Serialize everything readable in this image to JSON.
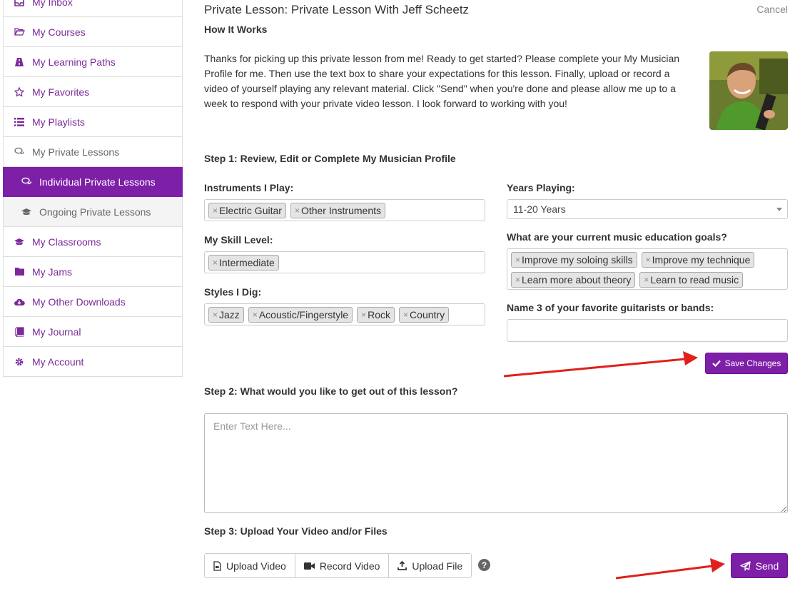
{
  "sidebar": {
    "items": [
      {
        "label": "My Inbox",
        "icon": "inbox-icon"
      },
      {
        "label": "My Courses",
        "icon": "folder-open-icon"
      },
      {
        "label": "My Learning Paths",
        "icon": "road-icon"
      },
      {
        "label": "My Favorites",
        "icon": "star-icon"
      },
      {
        "label": "My Playlists",
        "icon": "list-icon"
      },
      {
        "label": "My Private Lessons",
        "icon": "comments-icon"
      },
      {
        "label": "Individual Private Lessons",
        "icon": "comments-icon"
      },
      {
        "label": "Ongoing Private Lessons",
        "icon": "graduation-cap-icon"
      },
      {
        "label": "My Classrooms",
        "icon": "graduation-cap-icon"
      },
      {
        "label": "My Jams",
        "icon": "folder-music-icon"
      },
      {
        "label": "My Other Downloads",
        "icon": "cloud-download-icon"
      },
      {
        "label": "My Journal",
        "icon": "book-icon"
      },
      {
        "label": "My Account",
        "icon": "gear-icon"
      }
    ]
  },
  "header": {
    "title": "Private Lesson: Private Lesson With Jeff Scheetz",
    "cancel_label": "Cancel"
  },
  "intro": {
    "heading": "How It Works",
    "text": "Thanks for picking up this private lesson from me! Ready to get started? Please complete your My Musician Profile for me. Then use the text box to share your expectations for this lesson. Finally, upload or record a video of yourself playing any relevant material. Click \"Send\" when you're done and please allow me up to a week to respond with your private video lesson. I look forward to working with you!"
  },
  "step1": {
    "heading": "Step 1: Review, Edit or Complete My Musician Profile",
    "instruments": {
      "label": "Instruments I Play:",
      "tags": [
        "Electric Guitar",
        "Other Instruments"
      ]
    },
    "skill": {
      "label": "My Skill Level:",
      "tags": [
        "Intermediate"
      ]
    },
    "styles": {
      "label": "Styles I Dig:",
      "tags": [
        "Jazz",
        "Acoustic/Fingerstyle",
        "Rock",
        "Country"
      ]
    },
    "years": {
      "label": "Years Playing:",
      "value": "11-20 Years"
    },
    "goals": {
      "label": "What are your current music education goals?",
      "tags": [
        "Improve my soloing skills",
        "Improve my technique",
        "Learn more about theory",
        "Learn to read music"
      ]
    },
    "favorites": {
      "label": "Name 3 of your favorite guitarists or bands:",
      "value": ""
    },
    "save_label": "Save Changes",
    "remove_glyph": "×"
  },
  "step2": {
    "heading": "Step 2: What would you like to get out of this lesson?",
    "placeholder": "Enter Text Here..."
  },
  "step3": {
    "heading": "Step 3: Upload Your Video and/or Files",
    "upload_video": "Upload Video",
    "record_video": "Record Video",
    "upload_file": "Upload File",
    "help": "?",
    "send_label": "Send"
  },
  "colors": {
    "accent": "#7e1fa8",
    "link": "#7b2a97",
    "annotation_arrow": "#e0201b"
  }
}
